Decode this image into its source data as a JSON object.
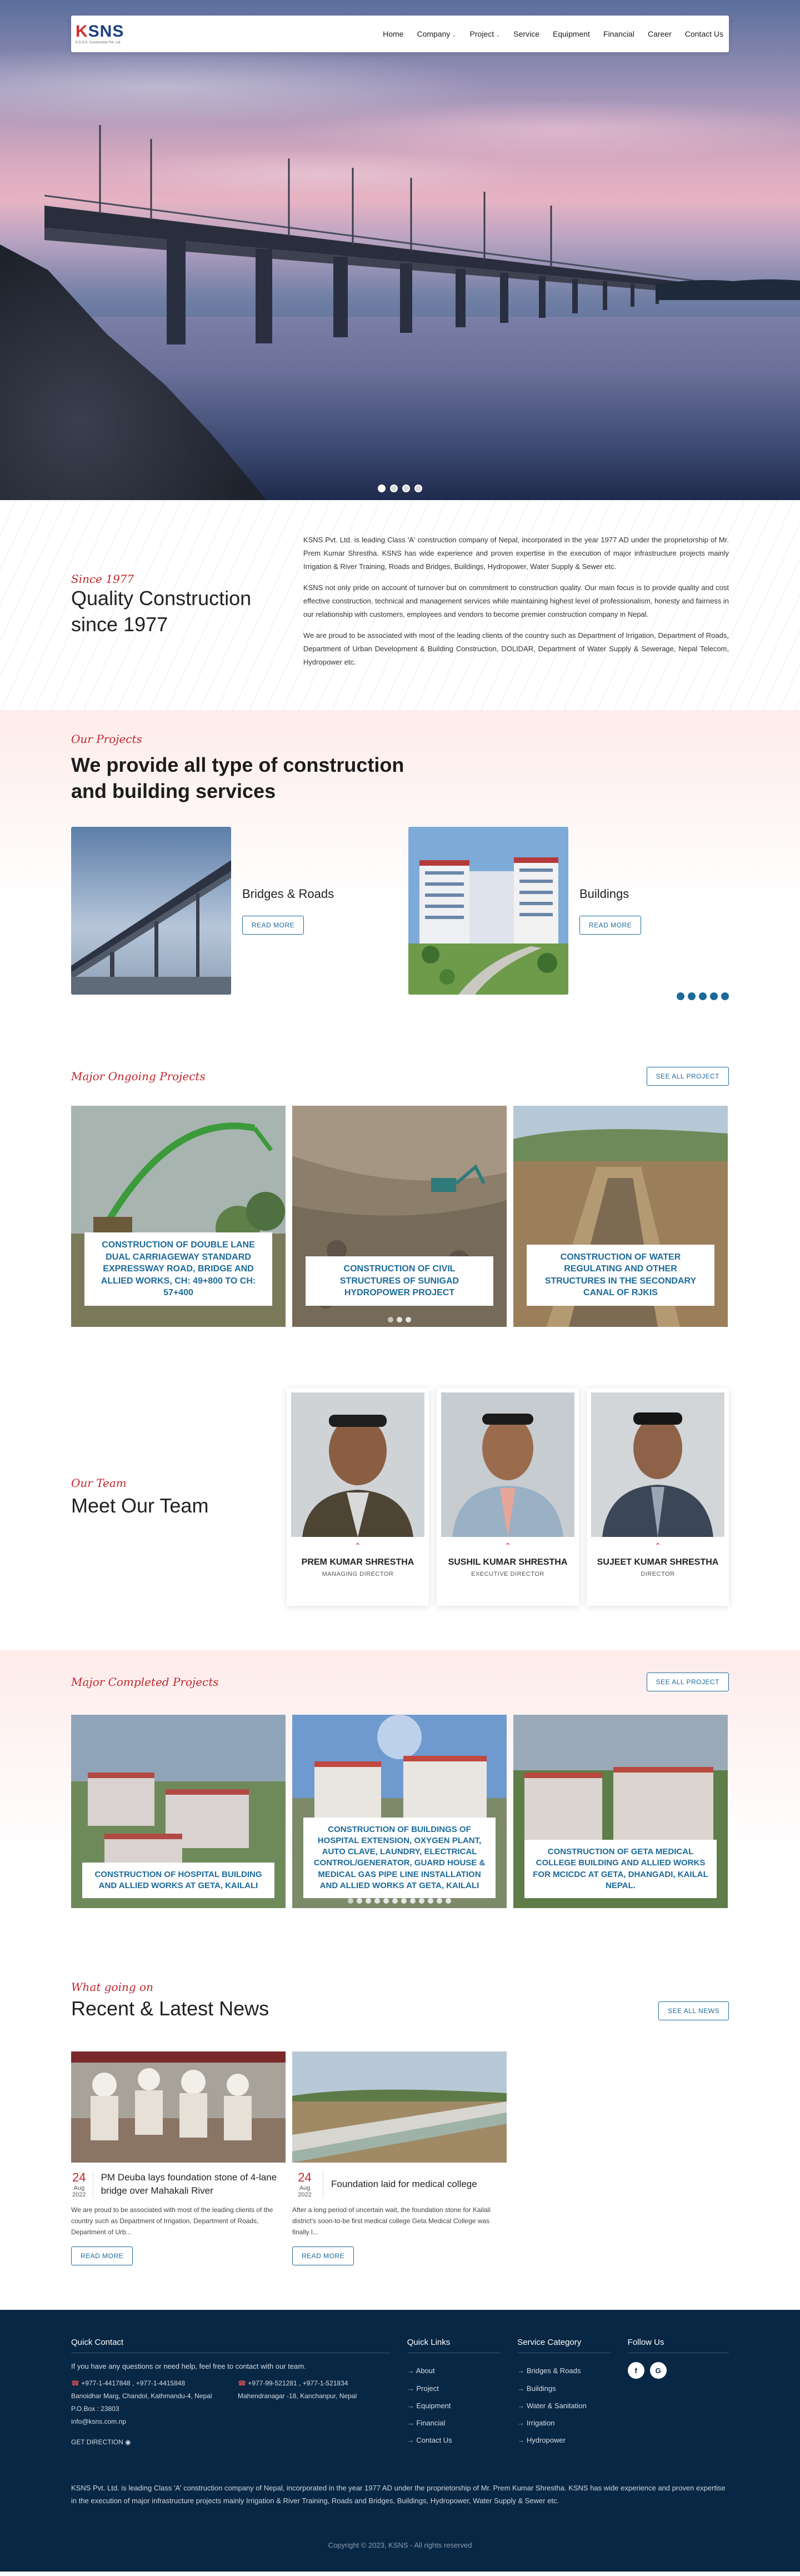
{
  "nav": {
    "logo_text": "KSNS",
    "logo_k": "K",
    "logo_rest": "SNS",
    "logo_tagline": "K.S.N.S. Construction Pvt. Ltd.",
    "items": [
      "Home",
      "Company",
      "Project",
      "Service",
      "Equipment",
      "Financial",
      "Career",
      "Contact Us"
    ]
  },
  "about": {
    "since": "Since 1977",
    "title": "Quality Construction since 1977",
    "p1": "KSNS Pvt. Ltd. is leading Class 'A' construction company of Nepal, incorporated in the year 1977 AD under the proprietorship of Mr. Prem Kumar Shrestha. KSNS has wide experience and proven expertise in the execution of major infrastructure projects mainly Irrigation & River Training, Roads and Bridges, Buildings, Hydropower, Water Supply & Sewer etc.",
    "p2": "KSNS not only pride on account of turnover but on commitment to construction quality. Our main focus is to provide quality and cost effective construction, technical and management services while maintaining highest level of professionalism, honesty and fairness in our relationship with customers, employees and vendors to become premier construction company in Nepal.",
    "p3": "We are proud to be associated with most of the leading clients of the country such as Department of Irrigation, Department of Roads, Department of Urban Development & Building Construction, DOLIDAR, Department of Water Supply & Sewerage, Nepal Telecom, Hydropower etc."
  },
  "projects": {
    "kicker": "Our Projects",
    "title": "We provide all type of construction and building services",
    "items": [
      {
        "name": "Bridges & Roads",
        "button": "READ MORE"
      },
      {
        "name": "Buildings",
        "button": "READ MORE"
      }
    ]
  },
  "ongoing": {
    "kicker": "Major Ongoing Projects",
    "button": "SEE ALL PROJECT",
    "items": [
      "CONSTRUCTION OF DOUBLE LANE DUAL CARRIAGEWAY STANDARD EXPRESSWAY ROAD, BRIDGE AND ALLIED WORKS, CH: 49+800 TO CH: 57+400",
      "CONSTRUCTION OF CIVIL STRUCTURES OF SUNIGAD HYDROPOWER PROJECT",
      "CONSTRUCTION OF WATER REGULATING AND OTHER STRUCTURES IN THE SECONDARY CANAL OF RJKIS"
    ]
  },
  "team": {
    "kicker": "Our Team",
    "title": "Meet Our Team",
    "members": [
      {
        "name": "PREM KUMAR SHRESTHA",
        "role": "MANAGING DIRECTOR"
      },
      {
        "name": "SUSHIL KUMAR SHRESTHA",
        "role": "EXECUTIVE DIRECTOR"
      },
      {
        "name": "SUJEET KUMAR SHRESTHA",
        "role": "DIRECTOR"
      }
    ]
  },
  "completed": {
    "kicker": "Major Completed Projects",
    "button": "SEE ALL PROJECT",
    "items": [
      "CONSTRUCTION OF HOSPITAL BUILDING AND ALLIED WORKS AT GETA, KAILALI",
      "CONSTRUCTION OF BUILDINGS OF HOSPITAL EXTENSION, OXYGEN PLANT, AUTO CLAVE, LAUNDRY, ELECTRICAL CONTROL/GENERATOR, GUARD HOUSE & MEDICAL GAS PIPE LINE INSTALLATION AND ALLIED WORKS AT GETA, KAILALI",
      "CONSTRUCTION OF GETA MEDICAL COLLEGE BUILDING AND ALLIED WORKS FOR MCICDC AT GETA, DHANGADI, KAILAL NEPAL."
    ]
  },
  "news": {
    "kicker": "What going on",
    "title": "Recent & Latest News",
    "button": "SEE ALL NEWS",
    "items": [
      {
        "day": "24",
        "month": "Aug 2022",
        "title": "PM Deuba lays foundation stone of 4-lane bridge over Mahakali River",
        "excerpt": "We are proud to be associated with most of the leading clients of the country such as Department of Irrigation, Department of Roads, Department of Urb...",
        "button": "READ MORE"
      },
      {
        "day": "24",
        "month": "Aug 2022",
        "title": "Foundation laid for medical college",
        "excerpt": "After a long period of uncertain wait, the foundation stone for Kailali district's soon-to-be first medical college Geta Medical College was finally l...",
        "button": "READ MORE"
      }
    ]
  },
  "footer": {
    "quick_contact_title": "Quick Contact",
    "quick_contact_text": "If you have any questions or need help, feel free to contact with our team.",
    "office1_phones": "+977-1-4417848 , +977-1-4415848",
    "office1_address": "Banoidhar Marg, Chandol, Kathmandu-4, Nepal",
    "office1_pobox": "P.O.Box : 23803",
    "office1_email": "info@ksns.com.np",
    "office2_phones": "+977-99-521281 , +977-1-521834",
    "office2_address": "Mahendranagar -18, Kanchanpur, Nepal",
    "directions": "GET DIRECTION",
    "quick_links_title": "Quick Links",
    "quick_links": [
      "About",
      "Project",
      "Equipment",
      "Financial",
      "Contact Us"
    ],
    "service_title": "Service Category",
    "services": [
      "Bridges & Roads",
      "Buildings",
      "Water & Sanitation",
      "Irrigation",
      "Hydropower"
    ],
    "follow_title": "Follow Us",
    "social": [
      "f",
      "G"
    ],
    "about": "KSNS Pvt. Ltd. is leading Class 'A' construction company of Nepal, incorporated in the year 1977 AD under the proprietorship of Mr. Prem Kumar Shrestha. KSNS has wide experience and proven expertise in the execution of major infrastructure projects mainly Irrigation & River Training, Roads and Bridges, Buildings, Hydropower, Water Supply & Sewer etc.",
    "copyright": "Copyright © 2023, KSNS - All rights reserved"
  }
}
